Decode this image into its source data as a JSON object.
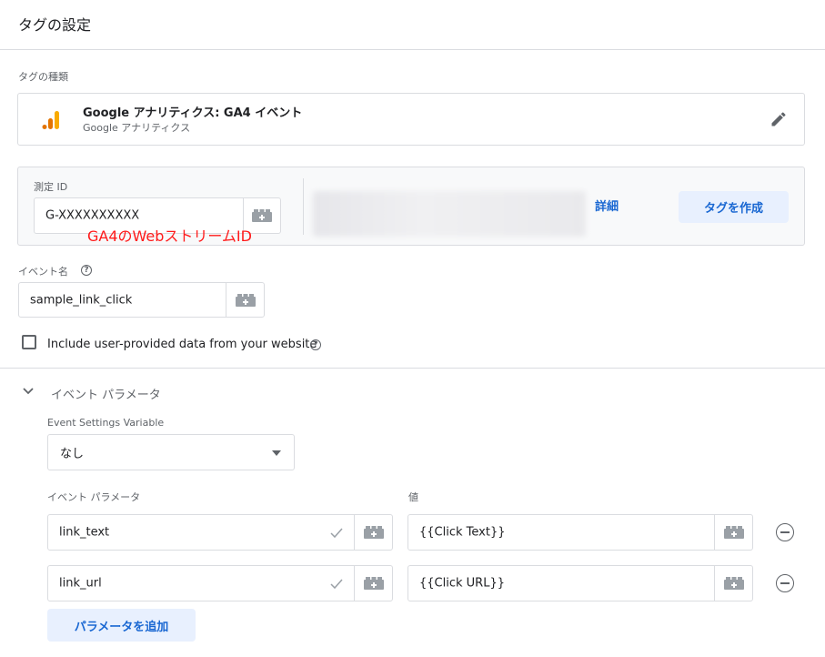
{
  "header": {
    "title": "タグの設定"
  },
  "tag_type": {
    "section_label": "タグの種類",
    "title": "Google アナリティクス: GA4 イベント",
    "subtitle": "Google アナリティクス",
    "edit_icon": "pencil-icon",
    "logo_colors": [
      "#f9ab00",
      "#e37400"
    ]
  },
  "measurement": {
    "label": "測定 ID",
    "value": "G-XXXXXXXXXX",
    "details_link": "詳細",
    "create_tag_button": "タグを作成"
  },
  "annotation": {
    "text": "GA4のWebストリームID",
    "color": "#ff1a1a"
  },
  "event_name": {
    "label": "イベント名",
    "value": "sample_link_click"
  },
  "user_data": {
    "label": "Include user-provided data from your website",
    "checked": false
  },
  "event_params": {
    "section_title": "イベント パラメータ",
    "settings_variable_label": "Event Settings Variable",
    "settings_variable_value": "なし",
    "col_param": "イベント パラメータ",
    "col_value": "値",
    "rows": [
      {
        "param": "link_text",
        "value": "{{Click Text}}"
      },
      {
        "param": "link_url",
        "value": "{{Click URL}}"
      }
    ],
    "add_button": "パラメータを追加"
  },
  "colors": {
    "accent": "#1967d2",
    "accent_bg": "#e8f0fe",
    "border": "#dadce0"
  }
}
